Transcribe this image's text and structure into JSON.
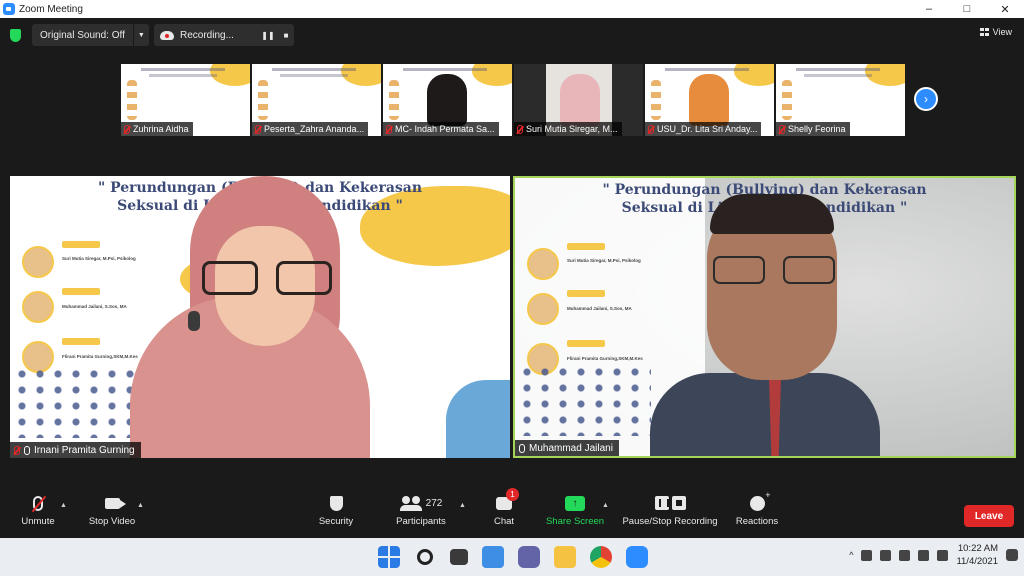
{
  "window": {
    "title": "Zoom Meeting",
    "controls": [
      "–",
      "□",
      "✕"
    ]
  },
  "topbar": {
    "original_sound": "Original Sound: Off",
    "recording": "Recording...",
    "view": "View"
  },
  "thumbnails": [
    {
      "name": "Zuhrina Aidha",
      "type": "slide"
    },
    {
      "name": "Peserta_Zahra Ananda...",
      "type": "slide"
    },
    {
      "name": "MC- Indah Permata Sa...",
      "type": "cam"
    },
    {
      "name": "Suri Mutia Siregar, M...",
      "type": "cam"
    },
    {
      "name": "USU_Dr. Lita Sri Anday...",
      "type": "slide"
    },
    {
      "name": "Shelly Feorina",
      "type": "slide"
    }
  ],
  "main_left": {
    "name": "Irnani Pramita Gurning",
    "slide_title_1": "\" Perundungan (Bullying) dan Kekerasan",
    "slide_title_2": "Seksual di Lingkungan Pendidikan \"",
    "speakers": [
      "Suri Mutia Siregar, M.Psi, Psikolog",
      "Muhammad Jailani, S.Sos, MA",
      "Flirani Pramita Gurning,SKM,M.Kes"
    ]
  },
  "main_right": {
    "name": "Muhammad Jailani",
    "slide_title_1": "\" Perundungan (Bullying) dan Kekerasan",
    "slide_title_2": "Seksual di Lingkungan Pendidikan \"",
    "speakers": [
      "Suri Mutia Siregar, M.Psi, Psikolog",
      "Muhammad Jailani, S.Sos, MA",
      "Flirani Pramita Gurning,SKM,M.Kes"
    ]
  },
  "toolbar": {
    "unmute": "Unmute",
    "stop_video": "Stop Video",
    "security": "Security",
    "participants": "Participants",
    "participant_count": "272",
    "chat": "Chat",
    "chat_badge": "1",
    "share_screen": "Share Screen",
    "pause_stop_recording": "Pause/Stop Recording",
    "reactions": "Reactions",
    "leave": "Leave"
  },
  "taskbar": {
    "time": "10:22 AM",
    "date": "11/4/2021"
  },
  "colors": {
    "zoom_blue": "#2d8cff",
    "leave_red": "#e02828",
    "share_green": "#23d959",
    "active_speaker_border": "#a4d55a"
  }
}
